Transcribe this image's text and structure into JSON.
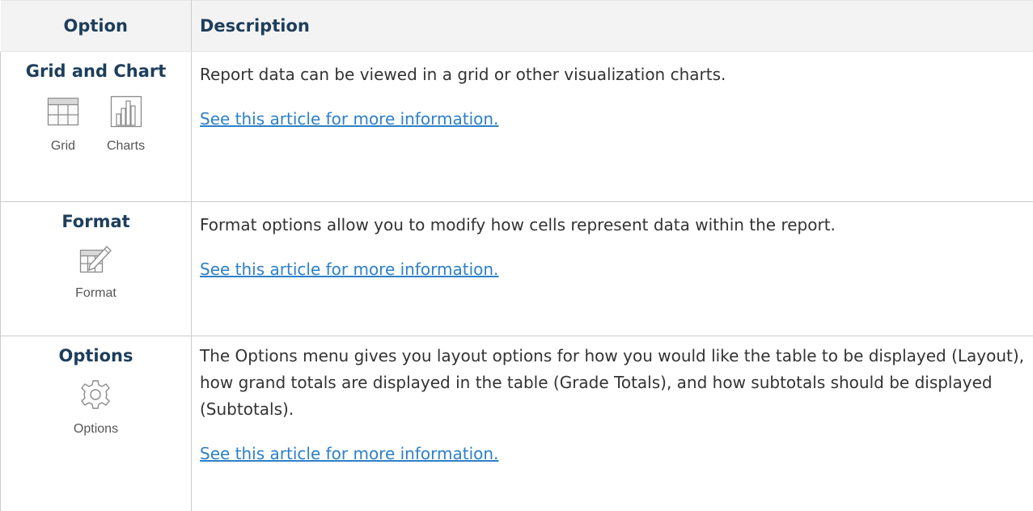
{
  "table": {
    "headers": {
      "option": "Option",
      "description": "Description"
    },
    "rows": [
      {
        "option": "Grid and Chart",
        "icons": [
          {
            "name": "grid-icon",
            "caption": "Grid"
          },
          {
            "name": "bar-chart-icon",
            "caption": "Charts"
          }
        ],
        "description": [
          "Report data can be viewed in a grid or other visualization charts."
        ],
        "link": "See this article for more information."
      },
      {
        "option": "Format",
        "icons": [
          {
            "name": "format-edit-icon",
            "caption": "Format"
          }
        ],
        "description": [
          "Format options allow you to modify how cells represent data within the report."
        ],
        "link": "See this article for more information."
      },
      {
        "option": "Options",
        "icons": [
          {
            "name": "gear-icon",
            "caption": "Options"
          }
        ],
        "description": [
          "The Options menu gives you layout options for how you would like the table to be displayed (Layout), how grand totals are displayed in the table (Grade Totals), and how subtotals should be displayed (Subtotals)."
        ],
        "link": "See this article for more information."
      }
    ]
  },
  "colors": {
    "header_bg": "#f3f3f3",
    "heading_text": "#1d3e5b",
    "link": "#2e80c7",
    "body_text": "#333333"
  }
}
